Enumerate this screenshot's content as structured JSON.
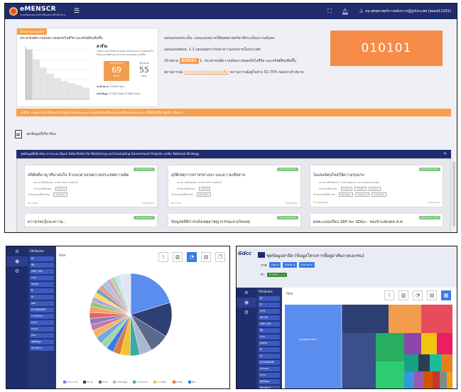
{
  "app": {
    "name": "eMENSCR",
    "subtitle": "ระบบติดตามและประเมินผลการดำเนินงาน"
  },
  "header": {
    "user_name": "ผอ.ยุทธศาสตร์การคลังการปฏิรูปประเทศ (ผอมส11201)"
  },
  "target_card": {
    "tag": "เป้าหมายแผนแม่บท",
    "title": "ประชาชนมีความมั่นคง ปลอดภัยในชีวิต และทรัพย์สินเพิ่มขึ้น",
    "indicator_title": "ตัวชี้วัด",
    "indicator_desc": "ระดับความสำเร็จของการรับรู้ความมั่นคงและความปลอดภัยในชีวิตและทรัพย์สินของประชาชน (MOGSOPS) เพิ่มขึ้น",
    "current_label": "สถานการณ์",
    "current_value": "69",
    "current_unit": "ร้อยละ",
    "target_label": "เป้าหมาย",
    "target_value": "55",
    "target_unit": "ร้อยละ",
    "meta1_label": "ค่าเป้าหมาย",
    "meta1_value": "ปี 2565 ร้อยละ",
    "meta2_label": "แหล่งข้อมูล",
    "meta2_value": "ปี 2565 ร้อยละ ปี 2566 ร้อยละ",
    "bars": [
      95,
      75,
      60,
      48,
      40,
      34,
      30,
      26,
      22
    ]
  },
  "info": {
    "plan_label": "แผนแม่บทประเด็น:",
    "plan_value": "แผนแม่บทภายใต้ยุทธศาสตร์ชาติประเด็นความมั่นคง",
    "subplan_label": "แผนแม่บทย่อย:",
    "subplan_value": "1.1 แผนย่อยการรักษาความสงบภายในประเทศ",
    "goal_label": "เป้าหมาย",
    "goal_code": "010101",
    "goal_value": "1. ประชาชนมีความมั่นคง ปลอดภัยในชีวิต และทรัพย์สินเพิ่มขึ้น",
    "status_label": "สถานการณ์:",
    "status_link": "ต่ำกว่าค่าเป้าหมายระดับเสี่ยง",
    "status_value": "สถานการณ์อยู่ในช่วง 51-75% ของค่าเป้าหมาย"
  },
  "code_box": "010101",
  "banner": "ตัวชี้วัด ระดับความสำเร็จของการรับรู้ความมั่นคงและความปลอดภัยในชีวิตและทรัพย์สินของประชาชน (MOGSOPS) เพิ่มขึ้น (ร้อยละ)",
  "docs_label": "ชุดข้อมูลที่เกี่ยวข้อง",
  "open_data_bar": "ชุดข้อมูลที่เกี่ยวข้อง จากระบบ Open Data Portal for Monitoring and Evaluating Government Projects under National Strategy",
  "cards": [
    {
      "title": "สถิติคดีอาญาที่น่าสนใจ จำแนกตามเขตภาคประเทศความผิด",
      "tag": "Open Government",
      "owner_label": "หน่วยงานที่รับผิดชอบ :",
      "owner": "สำนักงานตำรวจแห่งชาติ",
      "goal_label": "เป้าหมายที่เกี่ยวข้อง :",
      "goals": [
        "010101"
      ],
      "sub_label": "เป้าหมายย่อยที่เกี่ยวข้อง :",
      "subs": [
        "01010101"
      ],
      "foot_left": "Microsoft",
      "foot_right": "10/12/2564"
    },
    {
      "title": "อุบัติเหตุการจราจรทางบก และความเสียหาย",
      "tag": "Open Government",
      "owner_label": "หน่วยงานที่รับผิดชอบ :",
      "owner": "สำนักงานตำรวจแห่งชาติ",
      "goal_label": "เป้าหมายที่เกี่ยวข้อง :",
      "goals": [
        "010101"
      ],
      "sub_label": "เป้าหมายย่อยที่เกี่ยวข้อง :",
      "subs": [
        "01010101"
      ],
      "foot_left": "Microsoft",
      "foot_right": "10/12/2564"
    },
    {
      "title": "ไมเคลล์คนไทยใช้ความรุนแรง",
      "tag": "Open Government",
      "owner_label": "หน่วยงานที่รับผิดชอบ :",
      "owner": "สำนักงานพัฒนาการความมั่นคงของมนุษย์",
      "goal_label": "เป้าหมายที่เกี่ยวข้อง :",
      "goals": [
        "010101",
        "130101",
        "070101"
      ],
      "sub_label": "เป้าหมายย่อยที่เกี่ยวข้อง :",
      "subs": [
        "01010101",
        "13010101",
        "07010101"
      ],
      "foot_left": "ไม่ระบุหมวดหมู่",
      "foot_right": "10/12/2564"
    }
  ],
  "cards_row2": [
    {
      "title": "ความรอบรู้และความ...",
      "tag": "Open Government"
    },
    {
      "title": "ข้อมูลสถิติการแจ้งเหตุอาชญากรรมแลวเกิดเหตุ",
      "tag": "Open Government"
    },
    {
      "title": "ผลคะแนนเรียน SEP for SDGs : ขอเข้าแสดงผล ค.ศ.",
      "tag": "Open Government"
    }
  ],
  "bottom_left": {
    "attr_header": "Attributes",
    "attrs": [
      "ID",
      "ชื่อ",
      "UNIT_NO",
      "ภาค",
      "จังหวัด",
      "ปี",
      "ค่า",
      "เพศ",
      "FLOWNAME",
      "การจำแนก",
      "สาขา",
      "หมวด",
      "พ.ศ.",
      "ชุดข้อมูล",
      "หน่วยงาน"
    ],
    "filter": "Filter",
    "tools": [
      "line-chart",
      "bar-chart",
      "pie-chart",
      "column-chart",
      "copy"
    ],
    "legend": [
      "สถานการณ์",
      "สถานะ",
      "ปัจจัย",
      "แหล่งข้อมูล",
      "ค่าเป้าหมาย",
      "ความเสี่ยง",
      "ผลลัพธ์",
      "อื่นๆ"
    ],
    "pie": [
      {
        "v": 21,
        "c": "#5b8def"
      },
      {
        "v": 14,
        "c": "#2d3f73"
      },
      {
        "v": 8,
        "c": "#5a6a8a"
      },
      {
        "v": 5,
        "c": "#aab8cf"
      },
      {
        "v": 4,
        "c": "#3fa9a3"
      },
      {
        "v": 4,
        "c": "#f1c232"
      },
      {
        "v": 3,
        "c": "#e07b39"
      },
      {
        "v": 3,
        "c": "#3b7be5"
      },
      {
        "v": 3,
        "c": "#a5d6a7"
      },
      {
        "v": 3,
        "c": "#6fa8dc"
      },
      {
        "v": 3,
        "c": "#f6b26b"
      },
      {
        "v": 2.5,
        "c": "#c27ba0"
      },
      {
        "v": 2.5,
        "c": "#8e7cc3"
      },
      {
        "v": 2.5,
        "c": "#e06666"
      },
      {
        "v": 2.5,
        "c": "#f4a460"
      },
      {
        "v": 2,
        "c": "#93c47d"
      },
      {
        "v": 2,
        "c": "#b4a7d6"
      },
      {
        "v": 2,
        "c": "#ffd966"
      },
      {
        "v": 2,
        "c": "#76a5af"
      },
      {
        "v": 2,
        "c": "#ea9999"
      },
      {
        "v": 2,
        "c": "#9fc5e8"
      },
      {
        "v": 2,
        "c": "#d5a6bd"
      },
      {
        "v": 2,
        "c": "#b6d7a8"
      },
      {
        "v": 2,
        "c": "#cfe2f3"
      },
      {
        "v": 4.5,
        "c": "#dfe6f0"
      }
    ]
  },
  "bottom_right": {
    "logo": "Gdcc",
    "title": "ชุดข้อมูลสาธิต (ข้อมูลโครงการที่อยู่อาศัยภาคเอกชน)",
    "row1_label": "ภาค",
    "row1_pills": [
      "ภาค",
      "จังหวัด",
      "ประเภท"
    ],
    "row2_label": "ค่า",
    "row2_pill": "COUNT(...)",
    "attr_header": "Attributes",
    "attrs": [
      "ID",
      "ปี",
      "CTG",
      "AR CD",
      "UNIT_NO",
      "ชื่อ",
      "ภาค",
      "จังหวัด",
      "ปี",
      "ค่า",
      "FLOWNAME",
      "ประเภท",
      "สาขา",
      "ชุดข้อมูล",
      "หน่วยงาน",
      "ชื่อ"
    ],
    "filter": "Filter",
    "tools": [
      "line-chart",
      "bar-chart",
      "pie-chart",
      "column-chart",
      "treemap"
    ],
    "treemap_label": "กรุงเทพมหานคร"
  },
  "colors": {
    "navy": "#1f2d6e",
    "orange": "#f68b4a",
    "blue": "#3b7be5",
    "green": "#7bc67e"
  }
}
